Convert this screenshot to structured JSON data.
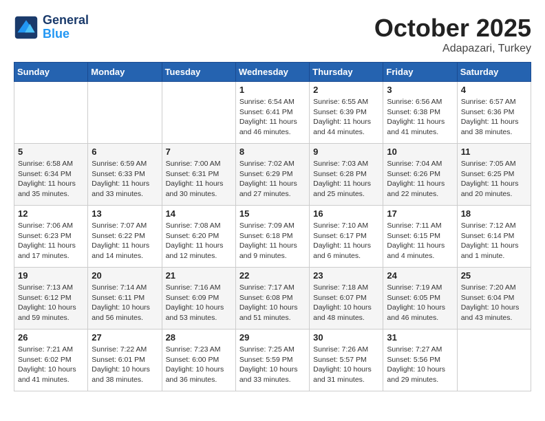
{
  "header": {
    "logo_line1": "General",
    "logo_line2": "Blue",
    "month": "October 2025",
    "location": "Adapazari, Turkey"
  },
  "weekdays": [
    "Sunday",
    "Monday",
    "Tuesday",
    "Wednesday",
    "Thursday",
    "Friday",
    "Saturday"
  ],
  "weeks": [
    [
      {
        "day": "",
        "info": ""
      },
      {
        "day": "",
        "info": ""
      },
      {
        "day": "",
        "info": ""
      },
      {
        "day": "1",
        "info": "Sunrise: 6:54 AM\nSunset: 6:41 PM\nDaylight: 11 hours\nand 46 minutes."
      },
      {
        "day": "2",
        "info": "Sunrise: 6:55 AM\nSunset: 6:39 PM\nDaylight: 11 hours\nand 44 minutes."
      },
      {
        "day": "3",
        "info": "Sunrise: 6:56 AM\nSunset: 6:38 PM\nDaylight: 11 hours\nand 41 minutes."
      },
      {
        "day": "4",
        "info": "Sunrise: 6:57 AM\nSunset: 6:36 PM\nDaylight: 11 hours\nand 38 minutes."
      }
    ],
    [
      {
        "day": "5",
        "info": "Sunrise: 6:58 AM\nSunset: 6:34 PM\nDaylight: 11 hours\nand 35 minutes."
      },
      {
        "day": "6",
        "info": "Sunrise: 6:59 AM\nSunset: 6:33 PM\nDaylight: 11 hours\nand 33 minutes."
      },
      {
        "day": "7",
        "info": "Sunrise: 7:00 AM\nSunset: 6:31 PM\nDaylight: 11 hours\nand 30 minutes."
      },
      {
        "day": "8",
        "info": "Sunrise: 7:02 AM\nSunset: 6:29 PM\nDaylight: 11 hours\nand 27 minutes."
      },
      {
        "day": "9",
        "info": "Sunrise: 7:03 AM\nSunset: 6:28 PM\nDaylight: 11 hours\nand 25 minutes."
      },
      {
        "day": "10",
        "info": "Sunrise: 7:04 AM\nSunset: 6:26 PM\nDaylight: 11 hours\nand 22 minutes."
      },
      {
        "day": "11",
        "info": "Sunrise: 7:05 AM\nSunset: 6:25 PM\nDaylight: 11 hours\nand 20 minutes."
      }
    ],
    [
      {
        "day": "12",
        "info": "Sunrise: 7:06 AM\nSunset: 6:23 PM\nDaylight: 11 hours\nand 17 minutes."
      },
      {
        "day": "13",
        "info": "Sunrise: 7:07 AM\nSunset: 6:22 PM\nDaylight: 11 hours\nand 14 minutes."
      },
      {
        "day": "14",
        "info": "Sunrise: 7:08 AM\nSunset: 6:20 PM\nDaylight: 11 hours\nand 12 minutes."
      },
      {
        "day": "15",
        "info": "Sunrise: 7:09 AM\nSunset: 6:18 PM\nDaylight: 11 hours\nand 9 minutes."
      },
      {
        "day": "16",
        "info": "Sunrise: 7:10 AM\nSunset: 6:17 PM\nDaylight: 11 hours\nand 6 minutes."
      },
      {
        "day": "17",
        "info": "Sunrise: 7:11 AM\nSunset: 6:15 PM\nDaylight: 11 hours\nand 4 minutes."
      },
      {
        "day": "18",
        "info": "Sunrise: 7:12 AM\nSunset: 6:14 PM\nDaylight: 11 hours\nand 1 minute."
      }
    ],
    [
      {
        "day": "19",
        "info": "Sunrise: 7:13 AM\nSunset: 6:12 PM\nDaylight: 10 hours\nand 59 minutes."
      },
      {
        "day": "20",
        "info": "Sunrise: 7:14 AM\nSunset: 6:11 PM\nDaylight: 10 hours\nand 56 minutes."
      },
      {
        "day": "21",
        "info": "Sunrise: 7:16 AM\nSunset: 6:09 PM\nDaylight: 10 hours\nand 53 minutes."
      },
      {
        "day": "22",
        "info": "Sunrise: 7:17 AM\nSunset: 6:08 PM\nDaylight: 10 hours\nand 51 minutes."
      },
      {
        "day": "23",
        "info": "Sunrise: 7:18 AM\nSunset: 6:07 PM\nDaylight: 10 hours\nand 48 minutes."
      },
      {
        "day": "24",
        "info": "Sunrise: 7:19 AM\nSunset: 6:05 PM\nDaylight: 10 hours\nand 46 minutes."
      },
      {
        "day": "25",
        "info": "Sunrise: 7:20 AM\nSunset: 6:04 PM\nDaylight: 10 hours\nand 43 minutes."
      }
    ],
    [
      {
        "day": "26",
        "info": "Sunrise: 7:21 AM\nSunset: 6:02 PM\nDaylight: 10 hours\nand 41 minutes."
      },
      {
        "day": "27",
        "info": "Sunrise: 7:22 AM\nSunset: 6:01 PM\nDaylight: 10 hours\nand 38 minutes."
      },
      {
        "day": "28",
        "info": "Sunrise: 7:23 AM\nSunset: 6:00 PM\nDaylight: 10 hours\nand 36 minutes."
      },
      {
        "day": "29",
        "info": "Sunrise: 7:25 AM\nSunset: 5:59 PM\nDaylight: 10 hours\nand 33 minutes."
      },
      {
        "day": "30",
        "info": "Sunrise: 7:26 AM\nSunset: 5:57 PM\nDaylight: 10 hours\nand 31 minutes."
      },
      {
        "day": "31",
        "info": "Sunrise: 7:27 AM\nSunset: 5:56 PM\nDaylight: 10 hours\nand 29 minutes."
      },
      {
        "day": "",
        "info": ""
      }
    ]
  ]
}
